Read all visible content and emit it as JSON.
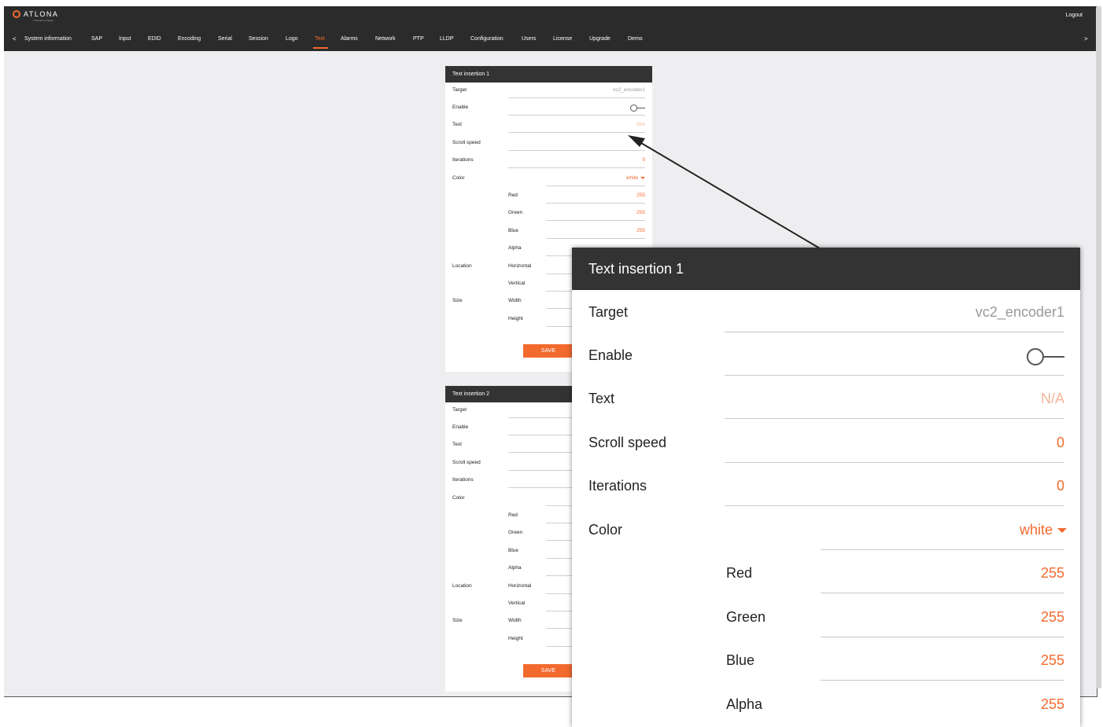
{
  "header": {
    "logo_text": "ATLONA",
    "logo_sub": "A Panduit company",
    "logout_label": "Logout",
    "nav_prev": "<",
    "nav_next": ">",
    "nav_items": [
      "System information",
      "SAP",
      "Input",
      "EDID",
      "Encoding",
      "Serial",
      "Session",
      "Logo",
      "Text",
      "Alarms",
      "Network",
      "PTP",
      "LLDP",
      "Configuration",
      "Users",
      "License",
      "Upgrade",
      "Demo"
    ],
    "active_item": "Text"
  },
  "card1": {
    "title": "Text insertion 1",
    "target_label": "Target",
    "target_value": "vc2_encoder1",
    "enable_label": "Enable",
    "text_label": "Text",
    "text_value": "N/A",
    "scroll_label": "Scroll speed",
    "iterations_label": "Iterations",
    "iterations_value": "0",
    "color_label": "Color",
    "color_value": "white",
    "red_label": "Red",
    "red_value": "255",
    "green_label": "Green",
    "green_value": "255",
    "blue_label": "Blue",
    "blue_value": "255",
    "alpha_label": "Alpha",
    "location_label": "Location",
    "horizontal_label": "Horizontal",
    "vertical_label": "Vertical",
    "size_label": "Size",
    "width_label": "Width",
    "height_label": "Height",
    "save_label": "SAVE"
  },
  "card2": {
    "title": "Text insertion 2",
    "target_label": "Target",
    "enable_label": "Enable",
    "text_label": "Text",
    "scroll_label": "Scroll speed",
    "iterations_label": "Iterations",
    "color_label": "Color",
    "red_label": "Red",
    "green_label": "Green",
    "blue_label": "Blue",
    "alpha_label": "Alpha",
    "location_label": "Location",
    "horizontal_label": "Horizontal",
    "vertical_label": "Vertical",
    "size_label": "Size",
    "width_label": "Width",
    "height_label": "Height",
    "save_label": "SAVE"
  },
  "zoom": {
    "title": "Text insertion 1",
    "target_label": "Target",
    "target_value": "vc2_encoder1",
    "enable_label": "Enable",
    "text_label": "Text",
    "text_value": "N/A",
    "scroll_label": "Scroll speed",
    "scroll_value": "0",
    "iterations_label": "Iterations",
    "iterations_value": "0",
    "color_label": "Color",
    "color_value": "white",
    "red_label": "Red",
    "red_value": "255",
    "green_label": "Green",
    "green_value": "255",
    "blue_label": "Blue",
    "blue_value": "255",
    "alpha_label": "Alpha",
    "alpha_value": "255"
  },
  "colors": {
    "accent": "#f26a2e",
    "topbar": "#2b2b2b",
    "panel_header": "#333333",
    "background": "#eeedef"
  }
}
